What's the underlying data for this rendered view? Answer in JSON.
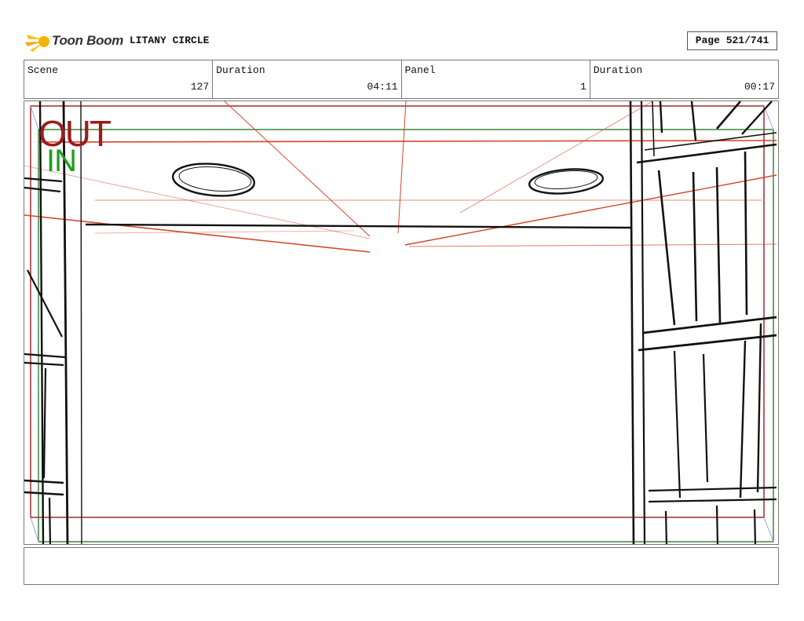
{
  "header": {
    "logo_text": "Toon Boom",
    "project_title": "LITANY CIRCLE",
    "page": "Page 521/741"
  },
  "info": {
    "scene_label": "Scene",
    "scene_value": "127",
    "scene_duration_label": "Duration",
    "scene_duration_value": "04:11",
    "panel_label": "Panel",
    "panel_value": "1",
    "panel_duration_label": "Duration",
    "panel_duration_value": "00:17"
  },
  "frame": {
    "out_label": "OUT",
    "in_label": "IN",
    "out_color": "#9b1b1b",
    "in_color": "#1e9e1e",
    "guide_color": "#d2462a"
  },
  "notes": ""
}
